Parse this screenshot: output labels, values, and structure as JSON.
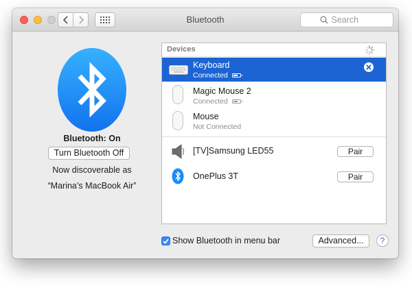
{
  "window": {
    "title": "Bluetooth"
  },
  "toolbar": {
    "search_placeholder": "Search",
    "back_icon": "chevron-left-icon",
    "forward_icon": "chevron-right-icon",
    "grid_icon": "grid-icon"
  },
  "left_panel": {
    "status": "Bluetooth: On",
    "toggle_button": "Turn Bluetooth Off",
    "discoverable_line1": "Now discoverable as",
    "discoverable_line2": "“Marina’s MacBook Air”"
  },
  "devices": {
    "header": "Devices",
    "paired": [
      {
        "name": "Keyboard",
        "status": "Connected",
        "icon": "keyboard-icon",
        "battery": 0.6,
        "selected": true
      },
      {
        "name": "Magic Mouse 2",
        "status": "Connected",
        "icon": "magic-mouse-icon",
        "battery": 0.6
      },
      {
        "name": "Mouse",
        "status": "Not Connected",
        "icon": "mouse-icon"
      }
    ],
    "nearby": [
      {
        "name": "[TV]Samsung LED55",
        "icon": "speaker-icon",
        "action": "Pair"
      },
      {
        "name": "OnePlus 3T",
        "icon": "bluetooth-icon",
        "action": "Pair"
      }
    ]
  },
  "footer": {
    "show_in_menu_bar_label": "Show Bluetooth in menu bar",
    "show_in_menu_bar_checked": true,
    "advanced_button": "Advanced...",
    "help_label": "?"
  },
  "colors": {
    "selection": "#1c64d4",
    "bluetooth_blue": "#1a8cf5",
    "close_red": "#fc605b",
    "minimize_yellow": "#fdbc40"
  }
}
